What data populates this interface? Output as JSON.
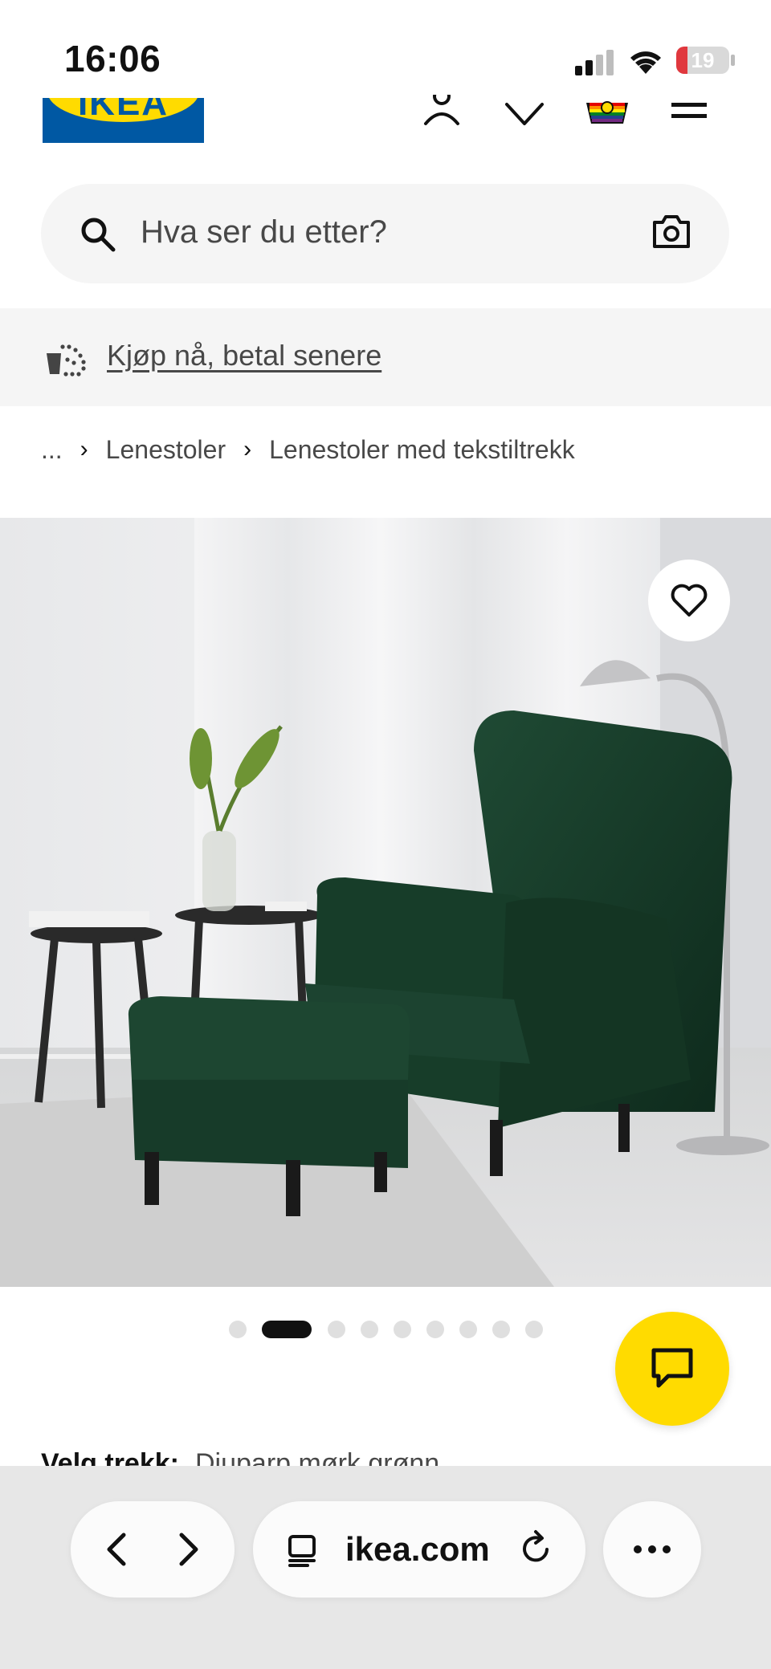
{
  "status_bar": {
    "time": "16:06",
    "battery_level": "19",
    "battery_color": "#e0383e"
  },
  "header": {
    "logo_text": "IKEA",
    "brand_blue": "#0058a3",
    "brand_yellow": "#ffdb00",
    "icons": [
      "user-icon",
      "heart-icon",
      "shopping-bag-icon",
      "menu-icon"
    ]
  },
  "search": {
    "placeholder": "Hva ser du etter?",
    "icons": [
      "search-icon",
      "camera-icon"
    ]
  },
  "promo": {
    "link_text": "Kjøp nå, betal senere",
    "icon": "payment-icon"
  },
  "breadcrumb": {
    "items": [
      "...",
      "Lenestoler",
      "Lenestoler med tekstiltrekk"
    ]
  },
  "gallery": {
    "image_count": 9,
    "active_index": 1,
    "favourite_icon": "heart-icon"
  },
  "product": {
    "variant_label": "Velg trekk:",
    "variant_value": "Djuparp mørk grønn"
  },
  "chat": {
    "icon": "chat-icon"
  },
  "browser": {
    "url": "ikea.com",
    "icons": [
      "back-icon",
      "forward-icon",
      "tabs-icon",
      "reload-icon",
      "more-icon"
    ]
  }
}
